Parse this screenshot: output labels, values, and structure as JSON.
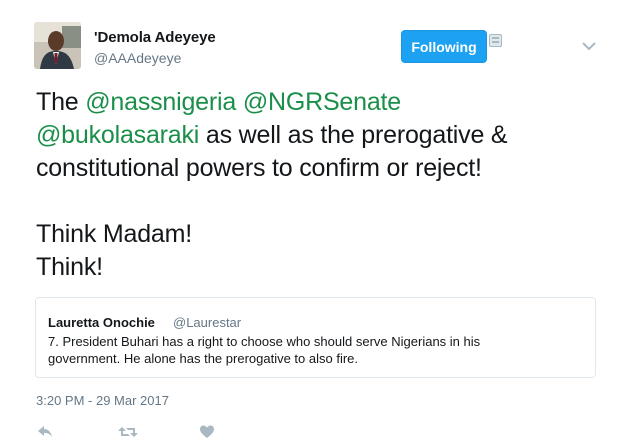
{
  "author": {
    "display_name": "'Demola Adeyeye",
    "handle": "@AAAdeyeye"
  },
  "follow_button": {
    "label": "Following"
  },
  "tweet": {
    "prefix": "The ",
    "mention_1": "@nassnigeria",
    "space_1": " ",
    "mention_2": "@NGRSenate",
    "mention_3": "@bukolasaraki",
    "rest": " as well as the prerogative & constitutional powers to confirm or reject!",
    "line_2": "Think Madam!",
    "line_3": "Think!"
  },
  "quoted_tweet": {
    "display_name": "Lauretta Onochie",
    "handle": "@Laurestar",
    "text": "7. President Buhari has a right to choose who should serve Nigerians in his government. He alone has the prerogative to also fire."
  },
  "timestamp": "3:20 PM - 29 Mar 2017",
  "colors": {
    "accent_blue": "#1da1f2",
    "mention_green": "#1b8f4a",
    "muted_text": "#657786"
  },
  "icons": [
    "avatar",
    "follow-settings-icon",
    "chevron-down-icon",
    "reply-icon",
    "retweet-icon",
    "heart-icon"
  ]
}
